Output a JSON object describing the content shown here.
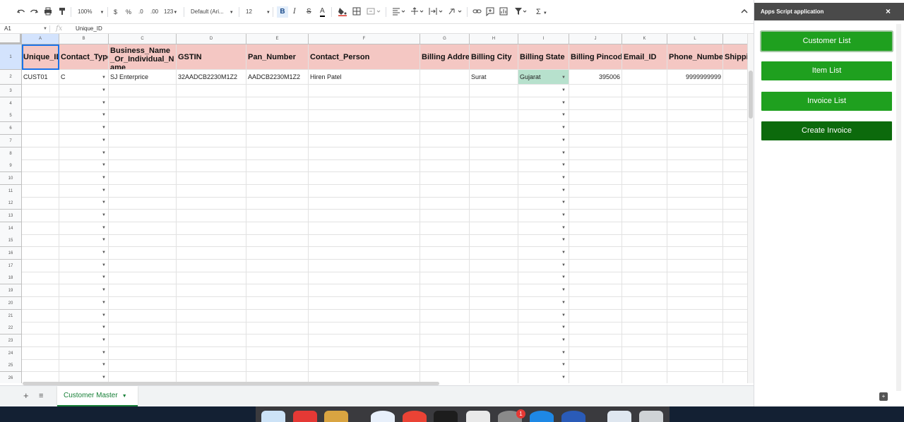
{
  "toolbar": {
    "zoom": "100%",
    "currency": "$",
    "percent": "%",
    "decimal_decrease": ".0",
    "decimal_increase": ".00",
    "more_formats": "123",
    "font": "Default (Ari...",
    "font_size": "12",
    "bold": "B",
    "italic": "I",
    "strike": "S",
    "text_color": "A",
    "functions": "Σ"
  },
  "formula_bar": {
    "cell_ref": "A1",
    "fx": "fx",
    "value": "Unique_ID"
  },
  "columns": [
    "A",
    "B",
    "C",
    "D",
    "E",
    "F",
    "G",
    "H",
    "I",
    "J",
    "K",
    "L"
  ],
  "headers": [
    "Unique_ID",
    "Contact_Type",
    "Business_Name_Or_Individual_Name",
    "GSTIN",
    "Pan_Number",
    "Contact_Person",
    "Billing Address",
    "Billing City",
    "Billing State",
    "Billing Pincode",
    "Email_ID",
    "Phone_Number",
    "Shipping"
  ],
  "row2": {
    "unique_id": "CUST01",
    "contact_type": "C",
    "business_name": "SJ Enterprice",
    "gstin": "32AADCB2230M1Z2",
    "pan": "AADCB2230M1Z2",
    "contact_person": "Hiren Patel",
    "billing_address": "",
    "billing_city": "Surat",
    "billing_state": "Gujarat",
    "billing_pincode": "395006",
    "email": "",
    "phone": "9999999999"
  },
  "row_numbers": [
    "1",
    "2",
    "3",
    "4",
    "5",
    "6",
    "7",
    "8",
    "9",
    "10",
    "11",
    "12",
    "13",
    "14",
    "15",
    "16",
    "17",
    "18",
    "19",
    "20",
    "21",
    "22",
    "23",
    "24",
    "25",
    "26"
  ],
  "sheet_tabs": {
    "add": "+",
    "all_sheets": "≡",
    "active": "Customer Master"
  },
  "panel": {
    "title": "Apps Script application",
    "close": "×",
    "buttons": [
      "Customer List",
      "Item List",
      "Invoice List",
      "Create Invoice"
    ]
  },
  "dock": {
    "badge": "1"
  },
  "colors": {
    "header_fill": "#f4c7c3",
    "state_fill": "#b7e1cd",
    "button_green": "#1fa01f",
    "button_dark": "#0c6a0c",
    "panel_header": "#4a4a4a",
    "tab_green": "#188038"
  }
}
